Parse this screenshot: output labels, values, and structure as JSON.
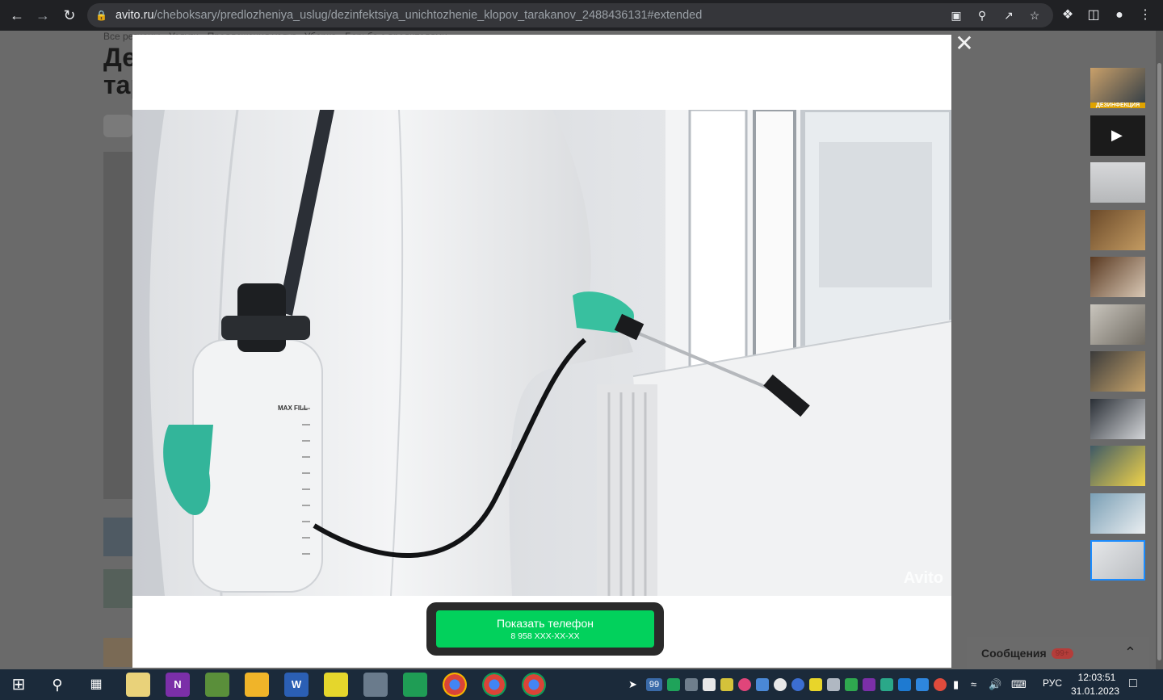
{
  "browser": {
    "url_host": "avito.ru",
    "url_path": "/cheboksary/predlozheniya_uslug/dezinfektsiya_unichtozhenie_klopov_tarakanov_2488436131#extended"
  },
  "background_page": {
    "breadcrumbs": "Все регионы · Услуги · Предложения услуг · Уборка · Борьба с вредителями",
    "title": "Де\nтар"
  },
  "lightbox": {
    "watermark": "Avito",
    "phone_button": {
      "label": "Показать телефон",
      "masked_number": "8 958 XXX-XX-XX"
    },
    "thumbnails": [
      {
        "caption": "ДЕЗИНФЕКЦИЯ",
        "kind": "image",
        "active": false
      },
      {
        "caption": "",
        "kind": "video",
        "active": false
      },
      {
        "caption": "",
        "kind": "image",
        "active": false
      },
      {
        "caption": "",
        "kind": "image",
        "active": false
      },
      {
        "caption": "",
        "kind": "image",
        "active": false
      },
      {
        "caption": "",
        "kind": "image",
        "active": false
      },
      {
        "caption": "",
        "kind": "image",
        "active": false
      },
      {
        "caption": "",
        "kind": "image",
        "active": false
      },
      {
        "caption": "",
        "kind": "image",
        "active": false
      },
      {
        "caption": "",
        "kind": "image",
        "active": false
      },
      {
        "caption": "",
        "kind": "image",
        "active": true
      }
    ],
    "photo_label": "MAX FILL"
  },
  "messages": {
    "label": "Сообщения",
    "badge": "99+"
  },
  "taskbar": {
    "tray_badge": "99",
    "language": "РУС",
    "time": "12:03:51",
    "date": "31.01.2023"
  },
  "colors": {
    "accent_green": "#02d15c",
    "browser_bg": "#202124",
    "overlay_bg": "#6a6a6a",
    "taskbar_bg": "#1b2a3a"
  }
}
